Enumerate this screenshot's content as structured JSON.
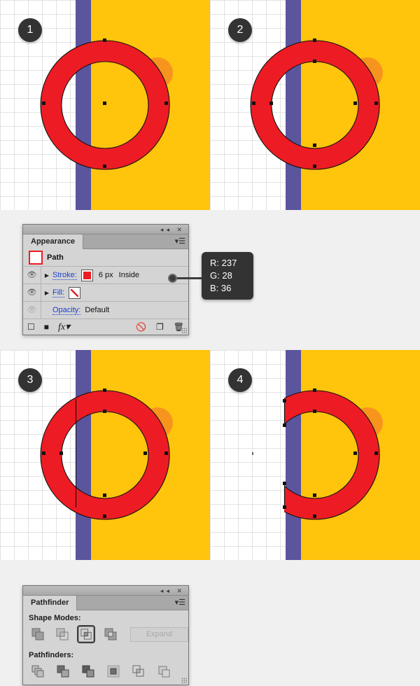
{
  "steps": [
    {
      "number": "1"
    },
    {
      "number": "2"
    },
    {
      "number": "3"
    },
    {
      "number": "4"
    }
  ],
  "colors": {
    "ring_red": "#ED1C24",
    "band_purple": "#5B559E",
    "band_yellow": "#FFC40C",
    "accent_orange": "#F7941E",
    "badge_dark": "#333333",
    "panel_gray": "#D4D4D4",
    "link_blue": "#1B3FCC",
    "canvas_bg": "#F0F0F0"
  },
  "appearance_panel": {
    "title": "Appearance",
    "tab_label": "Appearance",
    "collapse_icon": "collapse-icon",
    "close_icon": "close-icon",
    "menu_icon": "panel-menu-icon",
    "rows": [
      {
        "type": "object",
        "label": "Path",
        "thumbnail": "path-thumbnail"
      },
      {
        "type": "stroke",
        "visibility_icon": "eye-icon",
        "disclosure_icon": "triangle-right-icon",
        "label": "Stroke:",
        "swatch": "red-swatch",
        "weight": "6 px",
        "alignment": "Inside"
      },
      {
        "type": "fill",
        "visibility_icon": "eye-icon",
        "disclosure_icon": "triangle-right-icon",
        "label": "Fill:",
        "swatch": "none-swatch"
      },
      {
        "type": "opacity",
        "visibility_icon": "eye-icon-dim",
        "label": "Opacity:",
        "value": "Default"
      }
    ],
    "footer_icons": [
      "add-new-stroke-icon",
      "add-new-fill-icon",
      "add-effect-fx-icon",
      "clear-appearance-icon",
      "duplicate-item-icon",
      "delete-item-icon"
    ]
  },
  "tooltip": {
    "r_label": "R: 237",
    "g_label": "G: 28",
    "b_label": "B: 36"
  },
  "pathfinder_panel": {
    "title": "Pathfinder",
    "tab_label": "Pathfinder",
    "collapse_icon": "collapse-icon",
    "close_icon": "close-icon",
    "menu_icon": "panel-menu-icon",
    "shape_modes_label": "Shape Modes:",
    "pathfinders_label": "Pathfinders:",
    "expand_label": "Expand",
    "shape_modes": [
      {
        "name": "unite-icon",
        "selected": false
      },
      {
        "name": "minus-front-icon",
        "selected": false
      },
      {
        "name": "intersect-icon",
        "selected": true
      },
      {
        "name": "exclude-icon",
        "selected": false
      }
    ],
    "pathfinders": [
      {
        "name": "divide-icon"
      },
      {
        "name": "trim-icon"
      },
      {
        "name": "merge-icon"
      },
      {
        "name": "crop-icon"
      },
      {
        "name": "outline-icon"
      },
      {
        "name": "minus-back-icon"
      }
    ]
  }
}
